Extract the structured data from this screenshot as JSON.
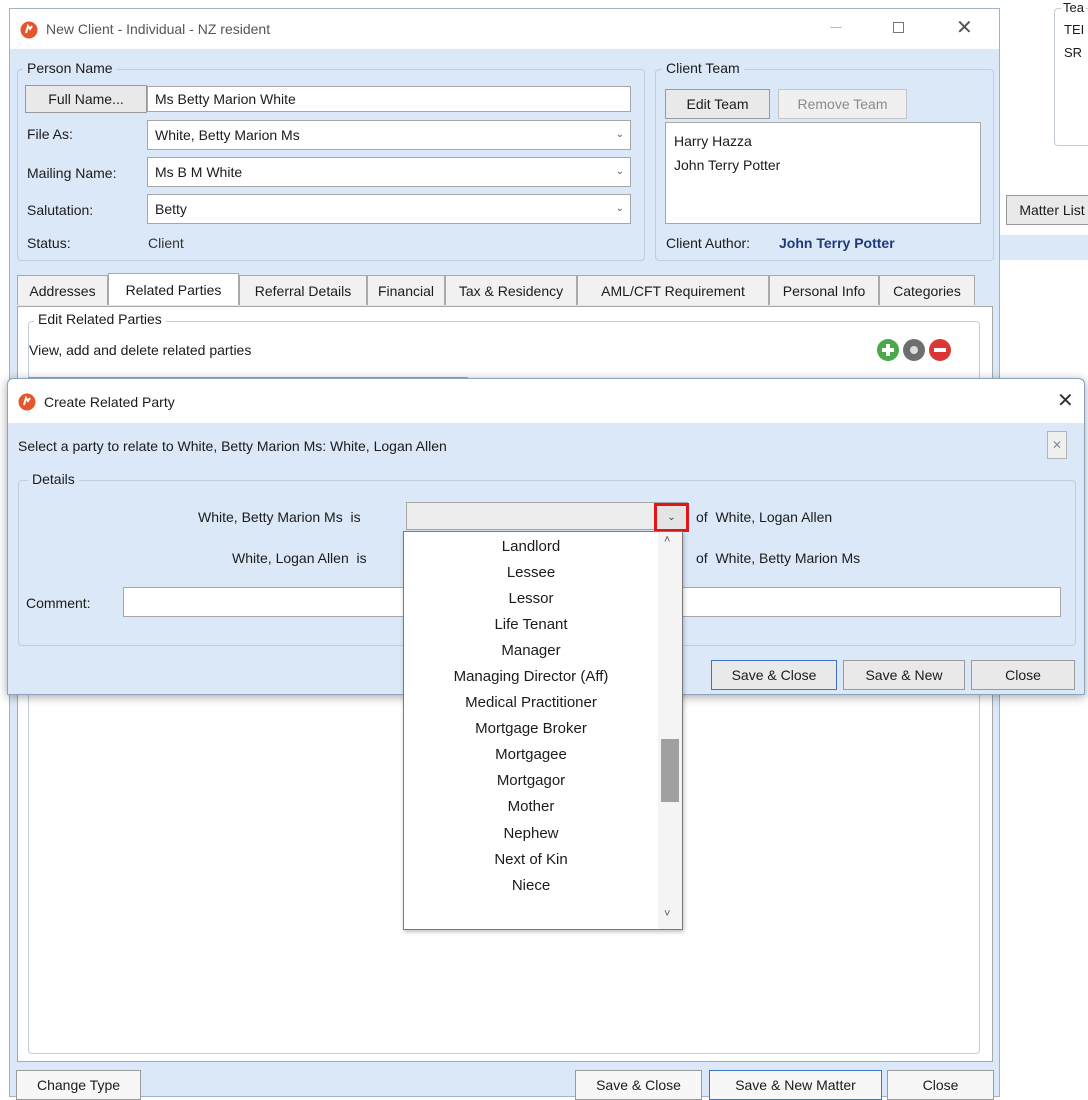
{
  "main_window": {
    "title": "New Client - Individual - NZ resident",
    "person_name": {
      "legend": "Person Name",
      "full_name_button": "Full Name...",
      "full_name_value": "Ms Betty Marion White",
      "file_as_label": "File As:",
      "file_as_value": "White, Betty Marion Ms",
      "mailing_name_label": "Mailing Name:",
      "mailing_name_value": "Ms B M White",
      "salutation_label": "Salutation:",
      "salutation_value": "Betty",
      "status_label": "Status:",
      "status_value": "Client"
    },
    "client_team": {
      "legend": "Client Team",
      "edit_team": "Edit Team",
      "remove_team": "Remove Team",
      "members": [
        "Harry Hazza",
        "John Terry Potter"
      ],
      "author_label": "Client Author:",
      "author_value": "John Terry Potter"
    },
    "tabs": [
      "Addresses",
      "Related Parties",
      "Referral Details",
      "Financial",
      "Tax & Residency",
      "AML/CFT Requirement",
      "Personal Info",
      "Categories"
    ],
    "active_tab": "Related Parties",
    "related_parties": {
      "legend": "Edit Related Parties",
      "description": "View, add and delete related parties"
    },
    "footer": {
      "change_type": "Change Type",
      "save_close": "Save & Close",
      "save_new_matter": "Save & New Matter",
      "close": "Close"
    }
  },
  "background": {
    "team_partial": "Tea",
    "line1": "TEI",
    "line2": "SR",
    "matter_list": "Matter List"
  },
  "dialog": {
    "title": "Create Related Party",
    "prompt": "Select a party to relate to White, Betty Marion Ms:",
    "selected_party": "White, Logan Allen",
    "details_legend": "Details",
    "row1_subject": "White, Betty Marion Ms",
    "row1_is": "is",
    "row1_of": "of",
    "row1_object": "White, Logan Allen",
    "row2_subject": "White, Logan Allen",
    "row2_is": "is",
    "row2_of": "of",
    "row2_object": "White, Betty Marion Ms",
    "comment_label": "Comment:",
    "save_close": "Save & Close",
    "save_new": "Save & New",
    "close": "Close"
  },
  "dropdown": {
    "items": [
      "Landlord",
      "Lessee",
      "Lessor",
      "Life Tenant",
      "Manager",
      "Managing Director (Aff)",
      "Medical Practitioner",
      "Mortgage Broker",
      "Mortgagee",
      "Mortgagor",
      "Mother",
      "Nephew",
      "Next of Kin",
      "Niece"
    ]
  },
  "colors": {
    "panel_blue": "#dbe8f7",
    "highlight_red": "#e0161b",
    "author_blue": "#1d3a78",
    "app_icon_orange": "#e4572e"
  },
  "icons": [
    "app-logo-icon",
    "minimize-icon",
    "maximize-icon",
    "close-icon",
    "add-icon",
    "gear-icon",
    "delete-icon",
    "chevron-down-icon",
    "chevron-up-icon"
  ]
}
